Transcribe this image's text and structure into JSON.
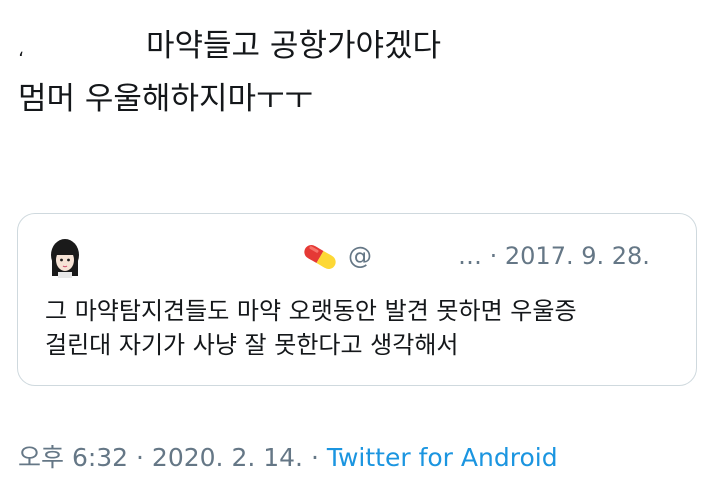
{
  "tweet": {
    "line1_mark": "،",
    "line1": "마약들고 공항가야겠다",
    "line2": "멈머 우울해하지마ㅜㅜ"
  },
  "quote": {
    "handle": "@",
    "date": "… · 2017. 9. 28.",
    "body_line1": "그 마약탐지견들도 마약 오랫동안 발견 못하면 우울증",
    "body_line2": "걸린대 자기가 사냥 잘 못한다고 생각해서"
  },
  "meta": {
    "time_date": "오후 6:32 · 2020. 2. 14. · ",
    "source": "Twitter for Android"
  },
  "colors": {
    "text": "#14171a",
    "secondary": "#657786",
    "link": "#1b95e0",
    "border": "#cfd9de"
  },
  "icons": {
    "avatar": "avatar-icon",
    "pill": "pill-emoji-icon"
  }
}
